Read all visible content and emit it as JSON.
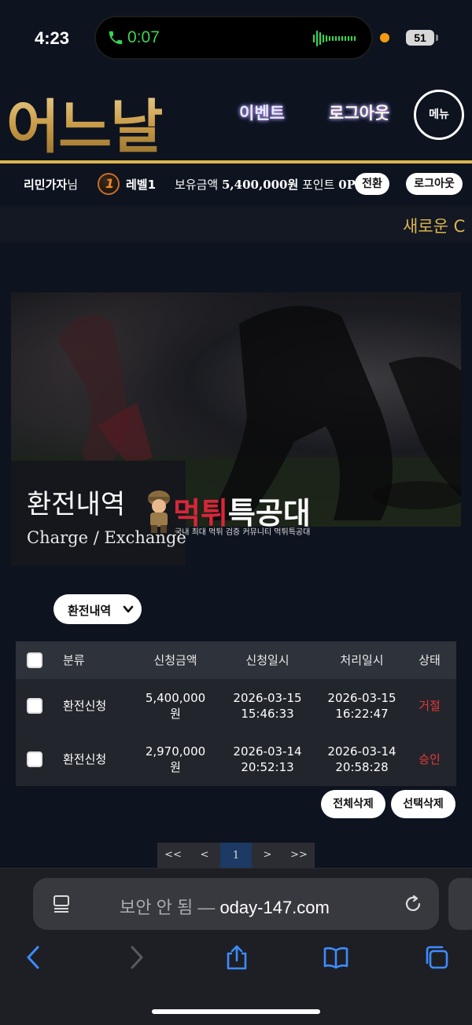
{
  "status_bar": {
    "time": "4:23",
    "call_duration": "0:07",
    "battery": "51"
  },
  "header": {
    "logo": "어느날",
    "nav": {
      "event": "이벤트",
      "logout": "로그아웃"
    },
    "menu_label": "메뉴"
  },
  "user_bar": {
    "name": "리민가자",
    "name_suffix": "님",
    "level_badge": "1",
    "level": "레벨1",
    "balance_label": "보유금액",
    "balance_value": "5,400,000원",
    "point_label": "포인트",
    "point_value": "0P",
    "convert_label": "전환",
    "logout_label": "로그아웃"
  },
  "marquee": {
    "text": "새로운 C"
  },
  "hero": {
    "title": "환전내역",
    "subtitle": "Charge / Exchange"
  },
  "watermark": {
    "title_red": "먹튀",
    "title_white": "특공대",
    "subtitle": "국내 최대 먹튀 검증 커뮤니티 먹튀특공대"
  },
  "filter": {
    "selected": "환전내역"
  },
  "table": {
    "headers": [
      "분류",
      "신청금액",
      "신청일시",
      "처리일시",
      "상태"
    ],
    "rows": [
      {
        "type": "환전신청",
        "amount_line1": "5,400,000",
        "amount_line2": "원",
        "req_date": "2026-03-15",
        "req_time": "15:46:33",
        "proc_date": "2026-03-15",
        "proc_time": "16:22:47",
        "status": "거절"
      },
      {
        "type": "환전신청",
        "amount_line1": "2,970,000",
        "amount_line2": "원",
        "req_date": "2026-03-14",
        "req_time": "20:52:13",
        "proc_date": "2026-03-14",
        "proc_time": "20:58:28",
        "status": "승인"
      }
    ],
    "status_color": "#e23b3b"
  },
  "actions": {
    "delete_all": "전체삭제",
    "delete_selected": "선택삭제"
  },
  "pagination": {
    "first": "<<",
    "prev": "<",
    "current": "1",
    "next": ">",
    "last": ">>"
  },
  "browser": {
    "insecure_label": "보안 안 됨 —",
    "domain": "oday-147.com"
  },
  "colors": {
    "accent_gold": "#d9b64f",
    "background": "#0e1320",
    "active_page": "#1c3a63"
  }
}
